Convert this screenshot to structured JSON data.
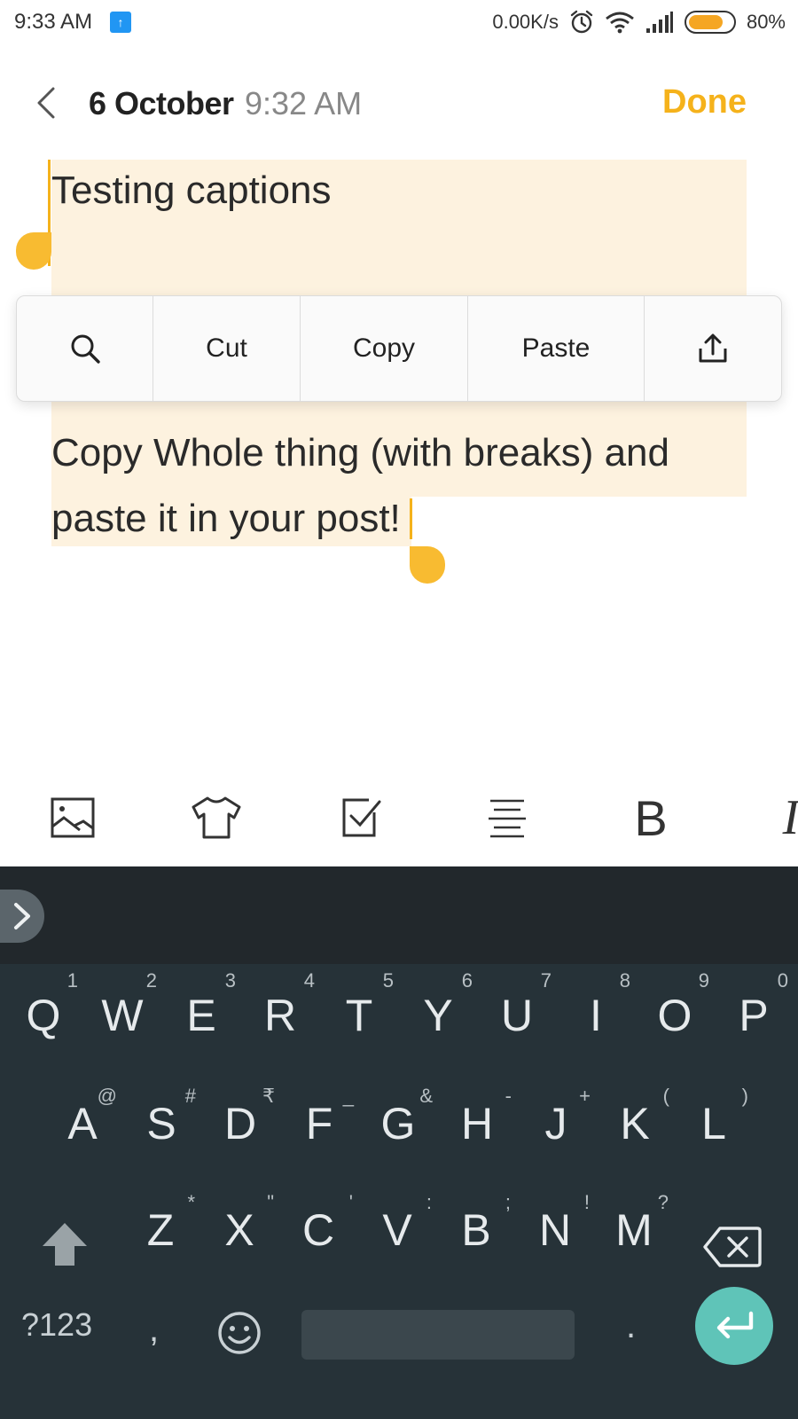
{
  "status_bar": {
    "time": "9:33 AM",
    "upload_icon": "upload-arrow-icon",
    "network_speed": "0.00K/s",
    "battery_percent": "80%",
    "battery_level": 0.8,
    "icons": [
      "alarm-icon",
      "wifi-icon",
      "signal-icon",
      "battery-icon"
    ]
  },
  "header": {
    "back_icon": "chevron-left-icon",
    "date": "6 October",
    "time": "9:32 AM",
    "done_label": "Done"
  },
  "editor": {
    "line1": "Testing captions",
    "line3": "Copy Whole thing (with breaks) and",
    "line4": "paste it in your post!"
  },
  "context_menu": {
    "search_icon": "search-icon",
    "cut": "Cut",
    "copy": "Copy",
    "paste": "Paste",
    "share_icon": "share-icon"
  },
  "format_toolbar": {
    "items": [
      "image-icon",
      "shirt-icon",
      "checkbox-icon",
      "align-icon",
      "bold-icon",
      "italic-icon"
    ],
    "bold_glyph": "B",
    "italic_glyph": "I"
  },
  "keyboard": {
    "row1": [
      {
        "key": "Q",
        "hint": "1"
      },
      {
        "key": "W",
        "hint": "2"
      },
      {
        "key": "E",
        "hint": "3"
      },
      {
        "key": "R",
        "hint": "4"
      },
      {
        "key": "T",
        "hint": "5"
      },
      {
        "key": "Y",
        "hint": "6"
      },
      {
        "key": "U",
        "hint": "7"
      },
      {
        "key": "I",
        "hint": "8"
      },
      {
        "key": "O",
        "hint": "9"
      },
      {
        "key": "P",
        "hint": "0"
      }
    ],
    "row2": [
      {
        "key": "A",
        "hint": "@"
      },
      {
        "key": "S",
        "hint": "#"
      },
      {
        "key": "D",
        "hint": "₹"
      },
      {
        "key": "F",
        "hint": "_"
      },
      {
        "key": "G",
        "hint": "&"
      },
      {
        "key": "H",
        "hint": "-"
      },
      {
        "key": "J",
        "hint": "+"
      },
      {
        "key": "K",
        "hint": "("
      },
      {
        "key": "L",
        "hint": ")"
      }
    ],
    "row3": [
      {
        "key": "Z",
        "hint": "*"
      },
      {
        "key": "X",
        "hint": "\""
      },
      {
        "key": "C",
        "hint": "'"
      },
      {
        "key": "V",
        "hint": ":"
      },
      {
        "key": "B",
        "hint": ";"
      },
      {
        "key": "N",
        "hint": "!"
      },
      {
        "key": "M",
        "hint": "?"
      }
    ],
    "symbols_label": "?123",
    "comma_label": ",",
    "period_label": ".",
    "accent_color": "#5fc4b8"
  }
}
